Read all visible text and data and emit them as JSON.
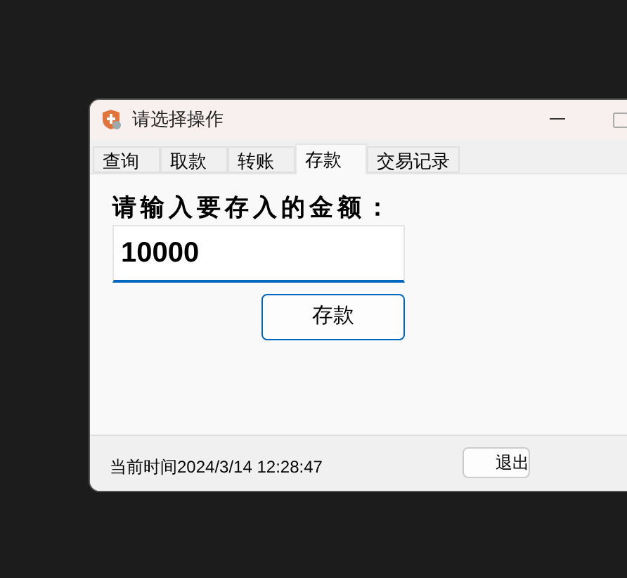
{
  "window": {
    "title": "请选择操作"
  },
  "tabs": [
    {
      "label": "查询",
      "selected": false
    },
    {
      "label": "取款",
      "selected": false
    },
    {
      "label": "转账",
      "selected": false
    },
    {
      "label": "存款",
      "selected": true
    },
    {
      "label": "交易记录",
      "selected": false
    }
  ],
  "deposit": {
    "prompt": "请输入要存入的金额：",
    "amount": "10000",
    "button": "存款"
  },
  "status_bar": {
    "time": "当前时间2024/3/14 12:28:47",
    "exit_button": "退出"
  }
}
